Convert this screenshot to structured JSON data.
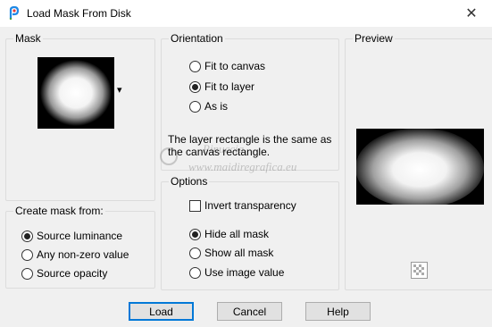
{
  "window": {
    "title": "Load Mask From Disk",
    "close_glyph": "✕"
  },
  "mask": {
    "label": "Mask",
    "dropdown_glyph": "▾"
  },
  "create_mask_from": {
    "label": "Create mask from:",
    "options": [
      "Source luminance",
      "Any non-zero value",
      "Source opacity"
    ],
    "selected": "Source luminance"
  },
  "orientation": {
    "label": "Orientation",
    "options": [
      "Fit to canvas",
      "Fit to layer",
      "As is"
    ],
    "selected": "Fit to layer",
    "info": "The layer rectangle is the same as the canvas rectangle."
  },
  "options": {
    "label": "Options",
    "invert_transparency": {
      "label": "Invert transparency",
      "checked": false
    },
    "radios": [
      "Hide all mask",
      "Show all mask",
      "Use image value"
    ],
    "selected": "Hide all mask"
  },
  "preview": {
    "label": "Preview"
  },
  "buttons": {
    "load": "Load",
    "cancel": "Cancel",
    "help": "Help"
  },
  "watermark": {
    "name": "Pinuccia",
    "site": "www.maidiregrafica.eu"
  },
  "colors": {
    "accent": "#0078d7",
    "dialog_bg": "#f0f0f0"
  }
}
